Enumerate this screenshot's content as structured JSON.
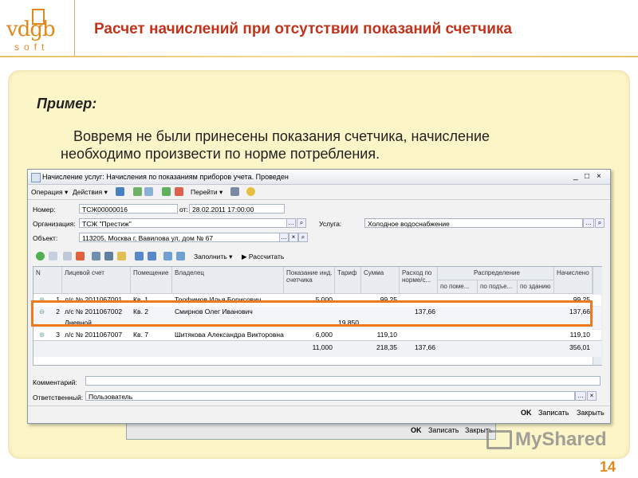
{
  "header": {
    "logo_text": "vdgb",
    "logo_sub": "soft",
    "title": "Расчет начислений при отсутствии показаний счетчика"
  },
  "slide": {
    "example_label": "Пример:",
    "description_line1": "Вовремя не были принесены показания счетчика, начисление",
    "description_line2": "необходимо произвести по норме потребления.",
    "page_number": "14",
    "watermark": "MyShared"
  },
  "window": {
    "title": "Начисление услуг: Начисления по показаниям приборов учета. Проведен",
    "controls": [
      "_",
      "□",
      "×"
    ],
    "toolbar": {
      "operation": "Операция",
      "actions": "Действия",
      "goto": "Перейти",
      "fill": "Заполнить",
      "calculate": "Рассчитать"
    },
    "form": {
      "number_label": "Номер:",
      "number_value": "ТСЖ00000016",
      "date_label": "от:",
      "date_value": "28.02.2011 17:00:00",
      "org_label": "Организация:",
      "org_value": "ТСЖ \"Престиж\"",
      "service_label": "Услуга:",
      "service_value": "Холодное водоснабжение",
      "object_label": "Объект:",
      "object_value": "113205, Москва г, Вавилова ул, дом № 67",
      "comment_label": "Комментарий:",
      "comment_value": "",
      "responsible_label": "Ответственный:",
      "responsible_value": "Пользователь"
    },
    "table": {
      "headers": {
        "num": "N",
        "account": "Лицевой счет",
        "room": "Помещение",
        "owner": "Владелец",
        "reading": "Показание инд. счетчика",
        "tariff": "Тариф",
        "sum": "Сумма",
        "norm": "Расход по норме/с...",
        "distribution": "Распределение",
        "dist_room": "по поме...",
        "dist_entrance": "по подъе...",
        "dist_building": "по зданию",
        "charged": "Начислено"
      },
      "rows": [
        {
          "n": "1",
          "account": "л/с № 2011067001",
          "room": "Кв. 1",
          "owner": "Трофимов Илья Борисович",
          "reading": "5,000",
          "tariff": "",
          "sum": "99,25",
          "norm": "",
          "charged": "99,25"
        },
        {
          "n": "2",
          "account": "л/с № 2011067002",
          "room": "Кв. 2",
          "owner": "Смирнов Олег Иванович",
          "reading": "",
          "tariff": "",
          "sum": "",
          "norm": "137,66",
          "charged": "137,66",
          "sub_label": "Дневной",
          "sub_tariff": "19,850"
        },
        {
          "n": "3",
          "account": "л/с № 2011067007",
          "room": "Кв. 7",
          "owner": "Шитякова Александра Викторовна",
          "reading": "6,000",
          "tariff": "",
          "sum": "119,10",
          "norm": "",
          "charged": "119,10"
        }
      ],
      "totals": {
        "reading": "11,000",
        "sum": "218,35",
        "norm": "137,66",
        "charged": "356,01"
      }
    },
    "buttons": {
      "ok": "OK",
      "write": "Записать",
      "close": "Закрыть"
    }
  },
  "back_window": {
    "buttons": {
      "ok": "OK",
      "write": "Записать",
      "close": "Закрыть"
    }
  }
}
